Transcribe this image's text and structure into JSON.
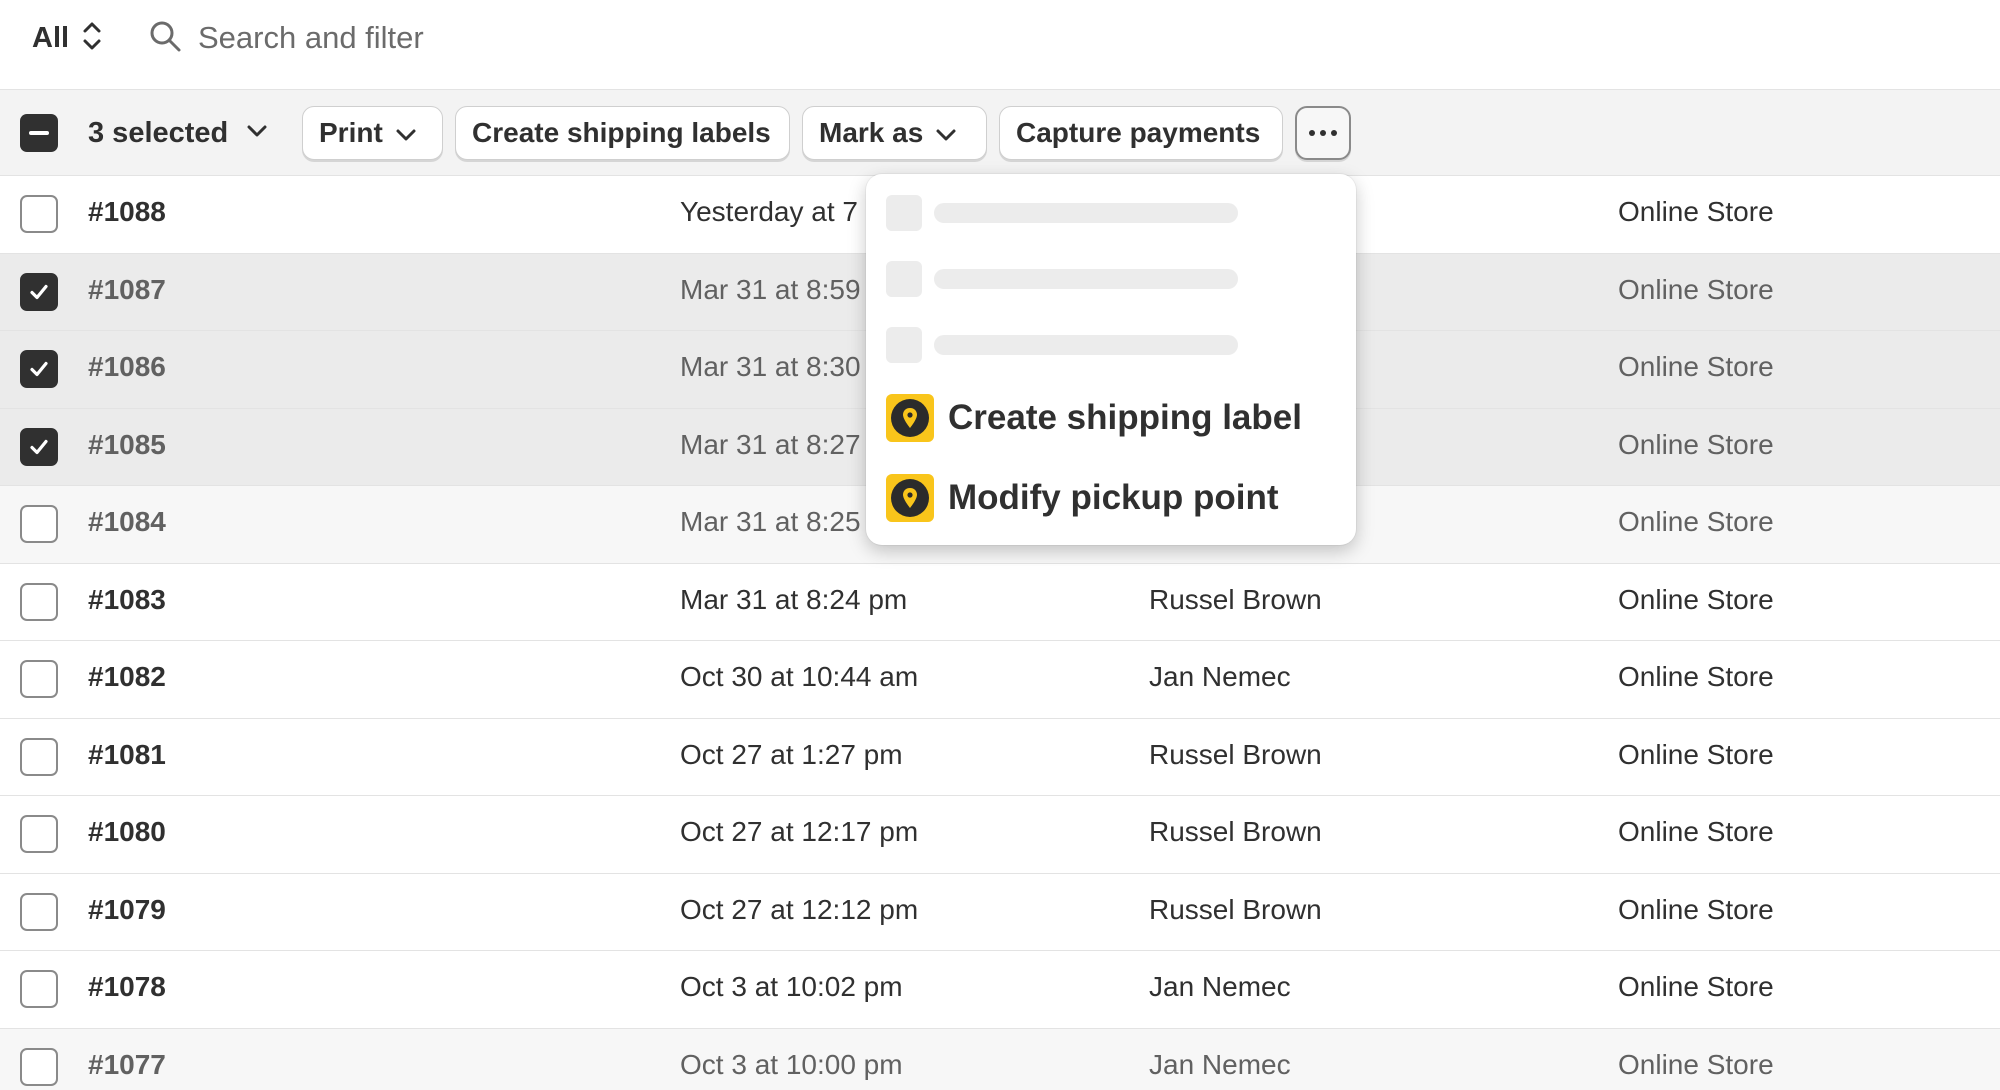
{
  "filter": {
    "view_label": "All",
    "search_placeholder": "Search and filter"
  },
  "bulk_actions": {
    "selected_label": "3 selected",
    "print_label": "Print",
    "create_labels_label": "Create shipping labels",
    "mark_as_label": "Mark as",
    "capture_label": "Capture payments"
  },
  "more_menu": {
    "items": [
      {
        "label": "Create shipping label",
        "icon": "pickup-point-app-icon"
      },
      {
        "label": "Modify pickup point",
        "icon": "pickup-point-app-icon"
      }
    ]
  },
  "orders": [
    {
      "order": "#1088",
      "date": "Yesterday at 7",
      "customer": "",
      "channel": "Online Store",
      "selected": false
    },
    {
      "order": "#1087",
      "date": "Mar 31 at 8:59",
      "customer": "",
      "channel": "Online Store",
      "selected": true
    },
    {
      "order": "#1086",
      "date": "Mar 31 at 8:30",
      "customer": "",
      "channel": "Online Store",
      "selected": true
    },
    {
      "order": "#1085",
      "date": "Mar 31 at 8:27",
      "customer": "",
      "channel": "Online Store",
      "selected": true
    },
    {
      "order": "#1084",
      "date": "Mar 31 at 8:25",
      "customer": "",
      "channel": "Online Store",
      "selected": false
    },
    {
      "order": "#1083",
      "date": "Mar 31 at 8:24 pm",
      "customer": "Russel Brown",
      "channel": "Online Store",
      "selected": false
    },
    {
      "order": "#1082",
      "date": "Oct 30 at 10:44 am",
      "customer": "Jan Nemec",
      "channel": "Online Store",
      "selected": false
    },
    {
      "order": "#1081",
      "date": "Oct 27 at 1:27 pm",
      "customer": "Russel Brown",
      "channel": "Online Store",
      "selected": false
    },
    {
      "order": "#1080",
      "date": "Oct 27 at 12:17 pm",
      "customer": "Russel Brown",
      "channel": "Online Store",
      "selected": false
    },
    {
      "order": "#1079",
      "date": "Oct 27 at 12:12 pm",
      "customer": "Russel Brown",
      "channel": "Online Store",
      "selected": false
    },
    {
      "order": "#1078",
      "date": "Oct 3 at 10:02 pm",
      "customer": "Jan Nemec",
      "channel": "Online Store",
      "selected": false
    },
    {
      "order": "#1077",
      "date": "Oct 3 at 10:00 pm",
      "customer": "Jan Nemec",
      "channel": "Online Store",
      "selected": false
    }
  ],
  "colors": {
    "text": "#303030",
    "muted_text": "#616161",
    "selected_row": "#ebebeb",
    "app_icon_bg": "#f9c51b"
  }
}
